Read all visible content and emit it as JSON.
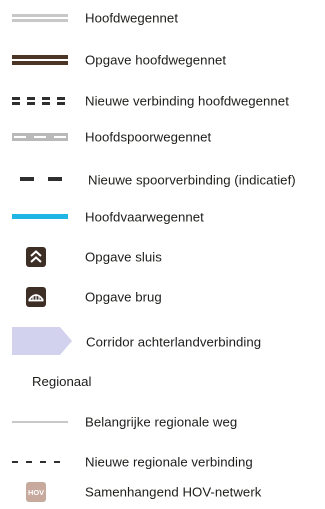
{
  "legend": {
    "items": [
      {
        "symbol": "double-grey-line-icon",
        "label": "Hoofdwegennet"
      },
      {
        "symbol": "dark-brown-double-line-icon",
        "label": "Opgave hoofdwegennet"
      },
      {
        "symbol": "dashed-dark-double-line-icon",
        "label": "Nieuwe verbinding hoofdwegennet"
      },
      {
        "symbol": "grey-railway-line-icon",
        "label": "Hoofdspoorwegennet"
      },
      {
        "symbol": "dark-dashed-line-icon",
        "label": "Nieuwe spoorverbinding (indicatief)"
      },
      {
        "symbol": "blue-waterway-line-icon",
        "label": "Hoofdvaarwegennet"
      },
      {
        "symbol": "lock-icon",
        "label": "Opgave sluis"
      },
      {
        "symbol": "bridge-icon",
        "label": "Opgave brug"
      },
      {
        "symbol": "lavender-arrow-corridor-icon",
        "label": "Corridor achterlandverbinding"
      }
    ],
    "section_title": "Regionaal",
    "regional_items": [
      {
        "symbol": "thin-grey-line-icon",
        "label": "Belangrijke regionale weg"
      },
      {
        "symbol": "dark-short-dash-line-icon",
        "label": "Nieuwe regionale verbinding"
      },
      {
        "symbol": "hov-badge-icon",
        "label": "Samenhangend HOV-netwerk",
        "badge_text": "HOV"
      }
    ],
    "colors": {
      "road_grey": "#c8c8c8",
      "road_brown": "#4a3526",
      "dash_dark": "#2f2f2f",
      "rail_grey": "#b9b9b9",
      "waterway_blue": "#1fb6e6",
      "icon_dark": "#3e2f26",
      "corridor_lavender": "#d3d2ee",
      "hov_tan": "#c7a99d"
    }
  }
}
